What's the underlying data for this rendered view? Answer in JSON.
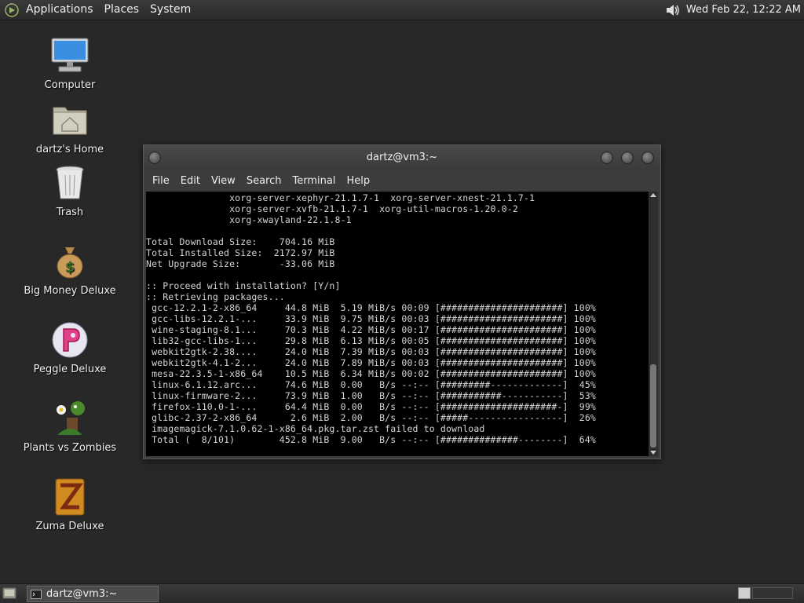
{
  "top_panel": {
    "menus": [
      "Applications",
      "Places",
      "System"
    ],
    "clock": "Wed Feb 22, 12:22 AM"
  },
  "desktop_icons": [
    {
      "label": "Computer",
      "icon": "computer-icon"
    },
    {
      "label": "dartz's Home",
      "icon": "home-folder-icon"
    },
    {
      "label": "Trash",
      "icon": "trash-icon"
    },
    {
      "label": "Big Money Deluxe",
      "icon": "money-bag-icon"
    },
    {
      "label": "Peggle Deluxe",
      "icon": "peggle-icon"
    },
    {
      "label": "Plants vs Zombies",
      "icon": "plants-icon"
    },
    {
      "label": "Zuma Deluxe",
      "icon": "zuma-icon"
    }
  ],
  "terminal": {
    "title": "dartz@vm3:~",
    "menus": [
      "File",
      "Edit",
      "View",
      "Search",
      "Terminal",
      "Help"
    ],
    "lines": [
      "               xorg-server-xephyr-21.1.7-1  xorg-server-xnest-21.1.7-1",
      "               xorg-server-xvfb-21.1.7-1  xorg-util-macros-1.20.0-2",
      "               xorg-xwayland-22.1.8-1",
      "",
      "Total Download Size:    704.16 MiB",
      "Total Installed Size:  2172.97 MiB",
      "Net Upgrade Size:       -33.06 MiB",
      "",
      ":: Proceed with installation? [Y/n]",
      ":: Retrieving packages...",
      " gcc-12.2.1-2-x86_64     44.8 MiB  5.19 MiB/s 00:09 [######################] 100%",
      " gcc-libs-12.2.1-...     33.9 MiB  9.75 MiB/s 00:03 [######################] 100%",
      " wine-staging-8.1...     70.3 MiB  4.22 MiB/s 00:17 [######################] 100%",
      " lib32-gcc-libs-1...     29.8 MiB  6.13 MiB/s 00:05 [######################] 100%",
      " webkit2gtk-2.38....     24.0 MiB  7.39 MiB/s 00:03 [######################] 100%",
      " webkit2gtk-4.1-2...     24.0 MiB  7.89 MiB/s 00:03 [######################] 100%",
      " mesa-22.3.5-1-x86_64    10.5 MiB  6.34 MiB/s 00:02 [######################] 100%",
      " linux-6.1.12.arc...     74.6 MiB  0.00   B/s --:-- [#########-------------]  45%",
      " linux-firmware-2...     73.9 MiB  1.00   B/s --:-- [###########-----------]  53%",
      " firefox-110.0-1-...     64.4 MiB  0.00   B/s --:-- [#####################-]  99%",
      " glibc-2.37-2-x86_64      2.6 MiB  2.00   B/s --:-- [#####-----------------]  26%",
      " imagemagick-7.1.0.62-1-x86_64.pkg.tar.zst failed to download",
      " Total (  8/101)        452.8 MiB  9.00   B/s --:-- [##############--------]  64%"
    ]
  },
  "bottom_panel": {
    "task_label": "dartz@vm3:~"
  }
}
